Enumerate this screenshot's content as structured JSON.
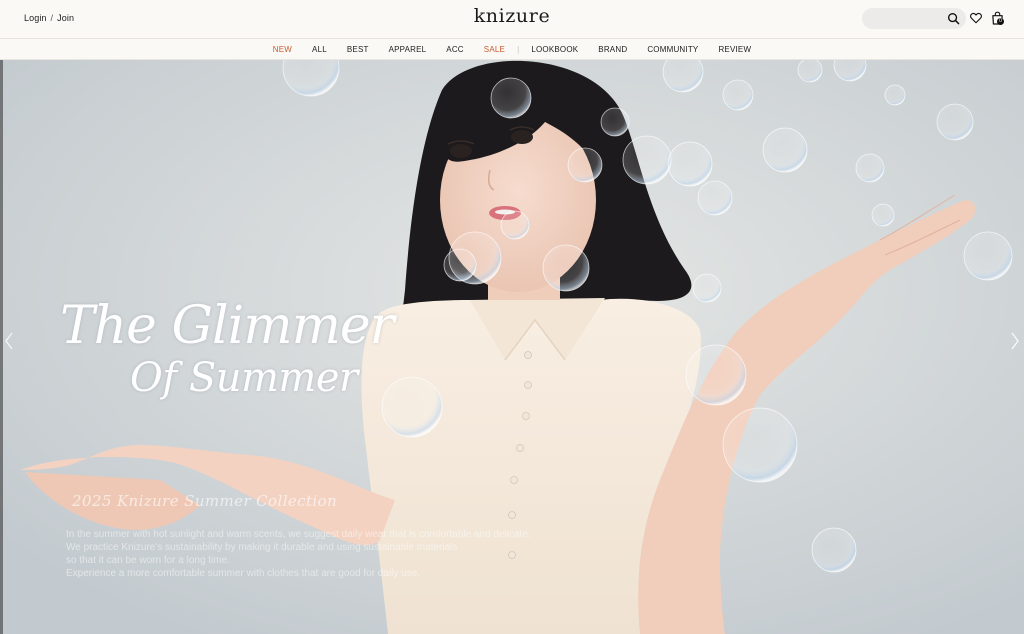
{
  "header": {
    "login_label": "Login",
    "separator": "/",
    "join_label": "Join",
    "logo_text": "knizure",
    "search_placeholder": "",
    "cart_count": "0"
  },
  "nav": {
    "items": [
      {
        "label": "NEW",
        "accent": true
      },
      {
        "label": "ALL",
        "accent": false
      },
      {
        "label": "BEST",
        "accent": false
      },
      {
        "label": "APPAREL",
        "accent": false
      },
      {
        "label": "ACC",
        "accent": false
      },
      {
        "label": "SALE",
        "accent": true
      },
      {
        "label": "LOOKBOOK",
        "accent": false
      },
      {
        "label": "BRAND",
        "accent": false
      },
      {
        "label": "COMMUNITY",
        "accent": false
      },
      {
        "label": "REVIEW",
        "accent": false
      }
    ],
    "accent_color": "#c85a2f"
  },
  "hero": {
    "headline_line1": "The Glimmer",
    "headline_line2": "Of Summer",
    "collection_label": "2025 Knizure Summer Collection",
    "description": [
      "In the summer with hot sunlight and warm scents, we suggest daily wear that is comfortable and delicate.",
      "We practice Knizure's sustainability by making it durable and using sustainable materials",
      "so that it can be worn for a long time.",
      "Experience a more comfortable summer with clothes that are good for daily use."
    ],
    "prev_arrow_icon": "chevron-left-icon",
    "next_arrow_icon": "chevron-right-icon"
  }
}
